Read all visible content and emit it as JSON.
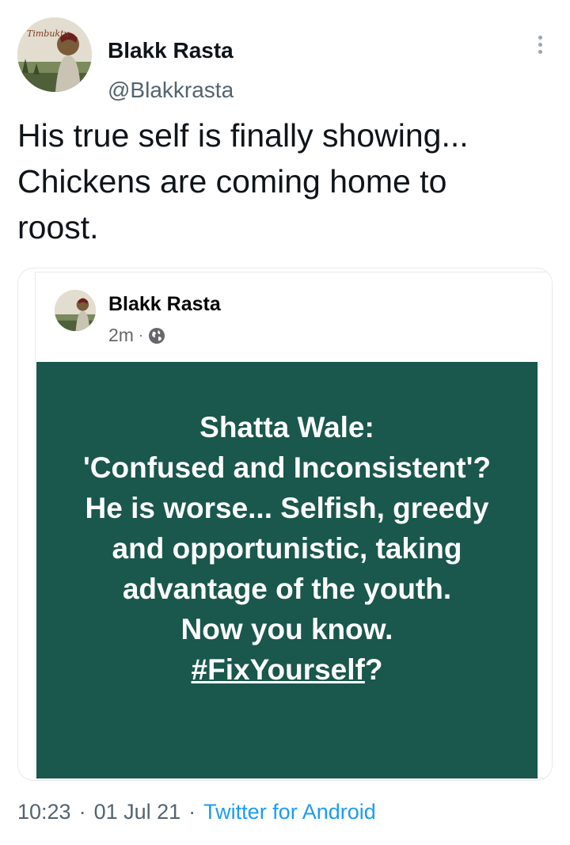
{
  "author": {
    "name": "Blakk Rasta",
    "handle": "@Blakkrasta",
    "avatar_text": "Timbuktu"
  },
  "tweet": {
    "text": "His true self is finally showing...\nChickens are coming home to\nroost."
  },
  "embedded_post": {
    "author_name": "Blakk Rasta",
    "time": "2m",
    "dot": "·",
    "quote_line1": "Shatta Wale:",
    "quote_line2": "'Confused and Inconsistent'? He is worse... Selfish, greedy and opportunistic, taking advantage of the youth.",
    "quote_line3": "Now you know.",
    "hashtag": "#FixYourself",
    "hashtag_suffix": "?"
  },
  "footer": {
    "time": "10:23",
    "sep1": "·",
    "date": "01 Jul 21",
    "sep2": "·",
    "source": "Twitter for Android",
    "source_color": "#1d9bf0"
  },
  "icons": {
    "more": "more-vertical-icon",
    "globe": "globe-icon"
  },
  "colors": {
    "quote_background": "#1a574c",
    "handle": "#536471"
  }
}
